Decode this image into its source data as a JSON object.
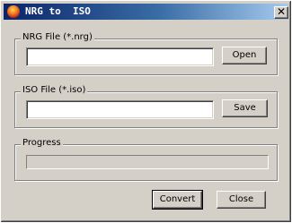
{
  "window": {
    "title": "NRG to  ISO",
    "close_glyph": "✕"
  },
  "nrg_group": {
    "label": "NRG File (*.nrg)",
    "input_value": "",
    "button_label": "Open"
  },
  "iso_group": {
    "label": "ISO File (*.iso)",
    "input_value": "",
    "button_label": "Save"
  },
  "progress_group": {
    "label": "Progress",
    "value_fraction": 0
  },
  "actions": {
    "convert_label": "Convert",
    "close_label": "Close"
  },
  "colors": {
    "face": "#d4d0c8",
    "title_active_start": "#0a246a",
    "title_active_end": "#a6caf0"
  }
}
